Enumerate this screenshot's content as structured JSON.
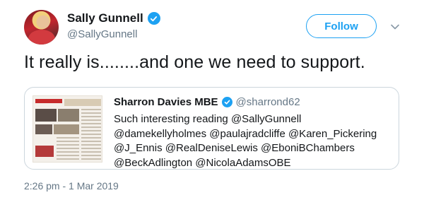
{
  "tweet": {
    "author": {
      "display_name": "Sally Gunnell",
      "handle": "@SallyGunnell",
      "verified": true
    },
    "follow_label": "Follow",
    "text": "It really is........and one we need to support.",
    "timestamp": "2:26 pm - 1 Mar 2019"
  },
  "quoted_tweet": {
    "author": {
      "display_name": "Sharron Davies MBE",
      "handle": "@sharrond62",
      "verified": true
    },
    "text": "Such interesting reading @SallyGunnell @damekellyholmes @paulajradcliffe @Karen_Pickering @J_Ennis @RealDeniseLewis @EboniBChambers @BeckAdlington @NicolaAdamsOBE"
  },
  "colors": {
    "accent": "#1da1f2",
    "text_primary": "#14171a",
    "text_secondary": "#657786",
    "border": "#ccd6dd"
  },
  "icons": {
    "verified": "verified-badge-icon",
    "caret": "chevron-down-icon"
  }
}
